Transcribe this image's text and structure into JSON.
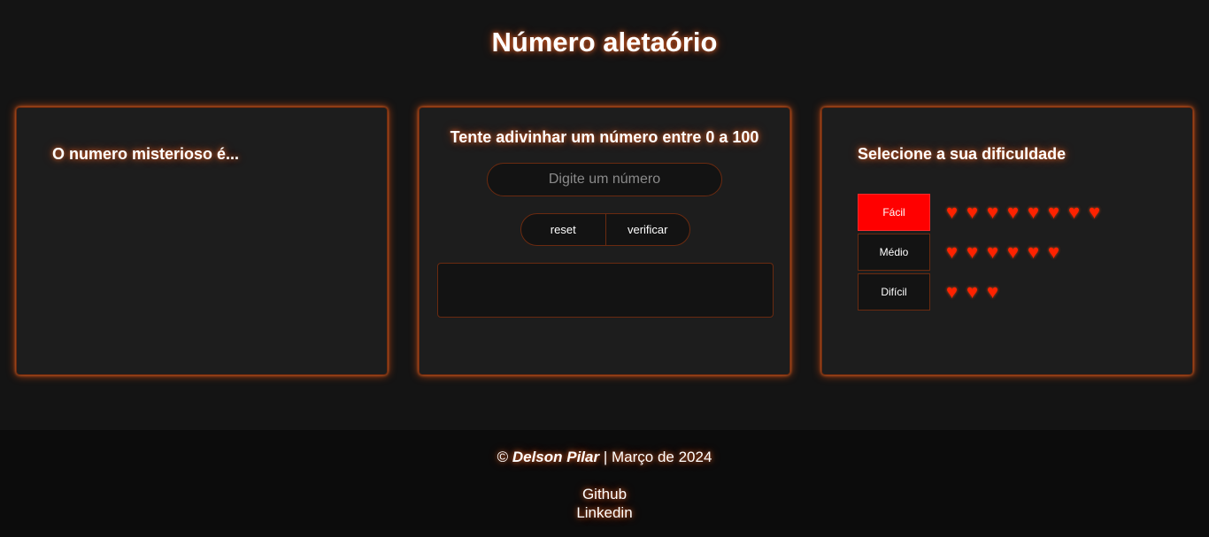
{
  "header": {
    "title": "Número aletaório"
  },
  "mystery": {
    "heading": "O numero misterioso é..."
  },
  "guess": {
    "heading": "Tente adivinhar um número entre 0 a 100",
    "input_placeholder": "Digite um número",
    "input_value": "",
    "reset_label": "reset",
    "verify_label": "verificar",
    "result_text": ""
  },
  "difficulty": {
    "heading": "Selecione a sua dificuldade",
    "levels": [
      {
        "label": "Fácil",
        "hearts": 8,
        "selected": true
      },
      {
        "label": "Médio",
        "hearts": 6,
        "selected": false
      },
      {
        "label": "Difícil",
        "hearts": 3,
        "selected": false
      }
    ],
    "heart_icon": "heart-icon"
  },
  "footer": {
    "copyright": "©",
    "author": "Delson Pilar",
    "separator": "|",
    "date": "Março de 2024",
    "links": [
      "Github",
      "Linkedin"
    ]
  },
  "colors": {
    "background": "#141414",
    "card_background": "#1d1d1d",
    "glow": "#ff5a14",
    "active": "#ff0000",
    "heart": "#ff2200"
  }
}
